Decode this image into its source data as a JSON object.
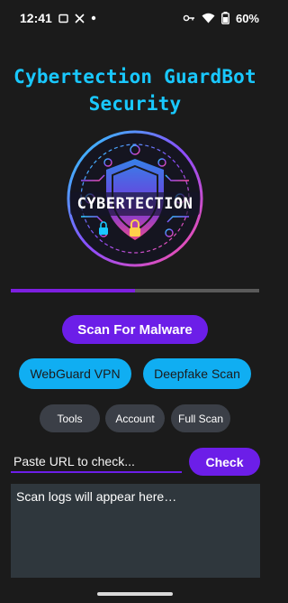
{
  "status_bar": {
    "time": "12:41",
    "notification_icons": [
      "message-icon",
      "x-icon",
      "dot-icon"
    ],
    "system_icons": [
      "key-icon",
      "wifi-icon",
      "battery-icon"
    ],
    "battery": "60%"
  },
  "app": {
    "title": "Cybertection GuardBot Security",
    "logo_text": "CYBERTECTION"
  },
  "progress": {
    "value_percent": 50
  },
  "buttons": {
    "scan_malware": "Scan For Malware",
    "webguard_vpn": "WebGuard VPN",
    "deepfake_scan": "Deepfake Scan",
    "tools": "Tools",
    "account": "Account",
    "full_scan": "Full Scan",
    "check": "Check"
  },
  "url_input": {
    "value": "",
    "placeholder": "Paste URL to check..."
  },
  "logs": {
    "text": "Scan logs will appear here…"
  },
  "colors": {
    "title": "#19c8ff",
    "primary": "#6c1ee8",
    "cyan": "#10aef2",
    "grey_button": "#3b3f47",
    "log_bg": "#2f373d"
  }
}
